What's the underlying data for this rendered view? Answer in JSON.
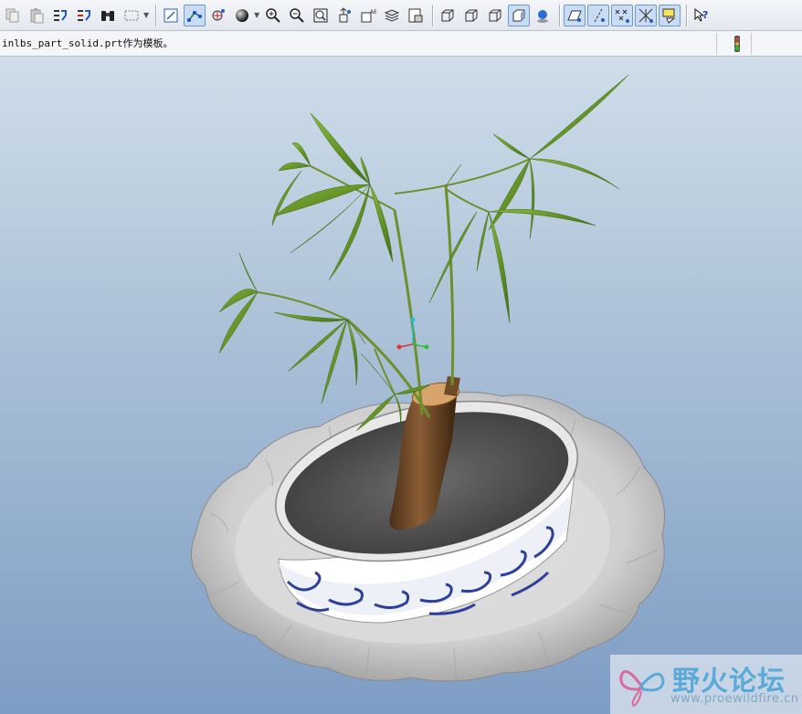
{
  "toolbar": {
    "buttons": [
      {
        "name": "copy-button",
        "icon": "copy-icon"
      },
      {
        "name": "paste-button",
        "icon": "paste-icon"
      },
      {
        "name": "regenerate-button",
        "icon": "regenerate-icon"
      },
      {
        "name": "regenerate-manager-button",
        "icon": "regenerate-manager-icon"
      },
      {
        "name": "find-button",
        "icon": "binoculars-icon"
      },
      {
        "name": "select-box-button",
        "icon": "select-box-icon"
      },
      {
        "name": "sketch-view-button",
        "icon": "sketch-icon"
      },
      {
        "name": "datum-display-button",
        "icon": "datum-icon"
      },
      {
        "name": "spin-center-button",
        "icon": "spin-center-icon"
      },
      {
        "name": "shading-button",
        "icon": "shading-sphere-icon"
      },
      {
        "name": "zoom-in-button",
        "icon": "zoom-in-icon"
      },
      {
        "name": "zoom-out-button",
        "icon": "zoom-out-icon"
      },
      {
        "name": "refit-button",
        "icon": "refit-icon"
      },
      {
        "name": "reorient-button",
        "icon": "reorient-icon"
      },
      {
        "name": "saved-views-button",
        "icon": "saved-views-icon"
      },
      {
        "name": "layers-button",
        "icon": "layers-icon"
      },
      {
        "name": "view-manager-button",
        "icon": "view-manager-icon"
      },
      {
        "name": "wireframe-button",
        "icon": "wireframe-icon"
      },
      {
        "name": "hidden-line-button",
        "icon": "hidden-line-icon"
      },
      {
        "name": "no-hidden-button",
        "icon": "no-hidden-icon"
      },
      {
        "name": "shaded-button",
        "icon": "shaded-icon"
      },
      {
        "name": "enhanced-realism-button",
        "icon": "realism-icon"
      },
      {
        "name": "datum-planes-button",
        "icon": "datum-planes-icon"
      },
      {
        "name": "datum-axes-button",
        "icon": "datum-axes-icon"
      },
      {
        "name": "datum-points-button",
        "icon": "datum-points-icon"
      },
      {
        "name": "coordinate-systems-button",
        "icon": "csys-icon"
      },
      {
        "name": "annotations-button",
        "icon": "annotations-icon"
      },
      {
        "name": "context-help-button",
        "icon": "help-icon"
      }
    ]
  },
  "message": {
    "text": "inlbs_part_solid.prt作为模板。"
  },
  "watermark": {
    "title": "野火论坛",
    "url": "www.proewildfire.cn"
  },
  "colors": {
    "viewport_top": "#cfdde9",
    "viewport_bottom": "#7e9dc4",
    "leaf": "#5f8f23",
    "trunk": "#7a5230",
    "pot_blue": "#2c3f9a",
    "soil": "#555555"
  }
}
